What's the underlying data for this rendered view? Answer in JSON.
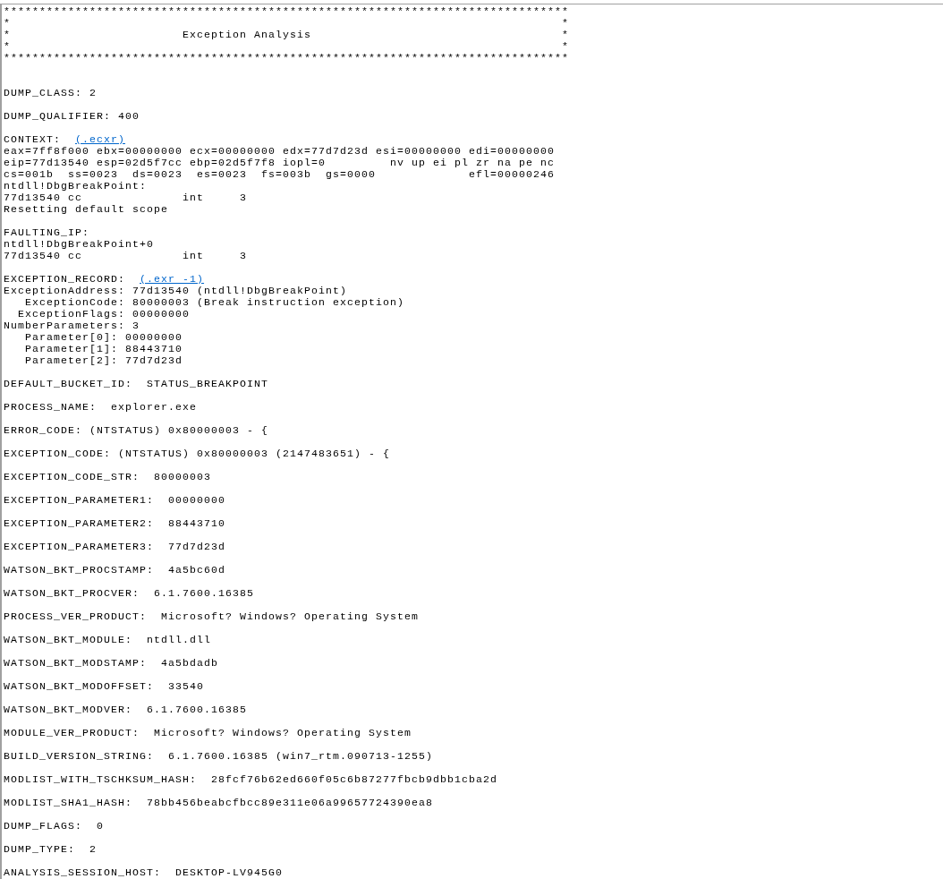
{
  "banner": "*******************************************************************************\n*                                                                             *\n*                        Exception Analysis                                   *\n*                                                                             *\n*******************************************************************************",
  "blocks": [
    [
      {
        "text": "DUMP_CLASS: 2"
      }
    ],
    [
      {
        "text": "DUMP_QUALIFIER: 400"
      }
    ],
    [
      {
        "text": "CONTEXT:  ",
        "link": "(.ecxr)"
      },
      {
        "text": "eax=7ff8f000 ebx=00000000 ecx=00000000 edx=77d7d23d esi=00000000 edi=00000000"
      },
      {
        "text": "eip=77d13540 esp=02d5f7cc ebp=02d5f7f8 iopl=0         nv up ei pl zr na pe nc"
      },
      {
        "text": "cs=001b  ss=0023  ds=0023  es=0023  fs=003b  gs=0000             efl=00000246"
      },
      {
        "text": "ntdll!DbgBreakPoint:"
      },
      {
        "text": "77d13540 cc              int     3"
      },
      {
        "text": "Resetting default scope"
      }
    ],
    [
      {
        "text": "FAULTING_IP: "
      },
      {
        "text": "ntdll!DbgBreakPoint+0"
      },
      {
        "text": "77d13540 cc              int     3"
      }
    ],
    [
      {
        "text": "EXCEPTION_RECORD:  ",
        "link": "(.exr -1)"
      },
      {
        "text": "ExceptionAddress: 77d13540 (ntdll!DbgBreakPoint)"
      },
      {
        "text": "   ExceptionCode: 80000003 (Break instruction exception)"
      },
      {
        "text": "  ExceptionFlags: 00000000"
      },
      {
        "text": "NumberParameters: 3"
      },
      {
        "text": "   Parameter[0]: 00000000"
      },
      {
        "text": "   Parameter[1]: 88443710"
      },
      {
        "text": "   Parameter[2]: 77d7d23d"
      }
    ],
    [
      {
        "text": "DEFAULT_BUCKET_ID:  STATUS_BREAKPOINT"
      }
    ],
    [
      {
        "text": "PROCESS_NAME:  explorer.exe"
      }
    ],
    [
      {
        "text": "ERROR_CODE: (NTSTATUS) 0x80000003 - {"
      }
    ],
    [
      {
        "text": "EXCEPTION_CODE: (NTSTATUS) 0x80000003 (2147483651) - {"
      }
    ],
    [
      {
        "text": "EXCEPTION_CODE_STR:  80000003"
      }
    ],
    [
      {
        "text": "EXCEPTION_PARAMETER1:  00000000"
      }
    ],
    [
      {
        "text": "EXCEPTION_PARAMETER2:  88443710"
      }
    ],
    [
      {
        "text": "EXCEPTION_PARAMETER3:  77d7d23d"
      }
    ],
    [
      {
        "text": "WATSON_BKT_PROCSTAMP:  4a5bc60d"
      }
    ],
    [
      {
        "text": "WATSON_BKT_PROCVER:  6.1.7600.16385"
      }
    ],
    [
      {
        "text": "PROCESS_VER_PRODUCT:  Microsoft? Windows? Operating System"
      }
    ],
    [
      {
        "text": "WATSON_BKT_MODULE:  ntdll.dll"
      }
    ],
    [
      {
        "text": "WATSON_BKT_MODSTAMP:  4a5bdadb"
      }
    ],
    [
      {
        "text": "WATSON_BKT_MODOFFSET:  33540"
      }
    ],
    [
      {
        "text": "WATSON_BKT_MODVER:  6.1.7600.16385"
      }
    ],
    [
      {
        "text": "MODULE_VER_PRODUCT:  Microsoft? Windows? Operating System"
      }
    ],
    [
      {
        "text": "BUILD_VERSION_STRING:  6.1.7600.16385 (win7_rtm.090713-1255)"
      }
    ],
    [
      {
        "text": "MODLIST_WITH_TSCHKSUM_HASH:  28fcf76b62ed660f05c6b87277fbcb9dbb1cba2d"
      }
    ],
    [
      {
        "text": "MODLIST_SHA1_HASH:  78bb456beabcfbcc89e311e06a99657724390ea8"
      }
    ],
    [
      {
        "text": "DUMP_FLAGS:  0"
      }
    ],
    [
      {
        "text": "DUMP_TYPE:  2"
      }
    ],
    [
      {
        "text": "ANALYSIS_SESSION_HOST:  DESKTOP-LV945G0"
      }
    ]
  ]
}
